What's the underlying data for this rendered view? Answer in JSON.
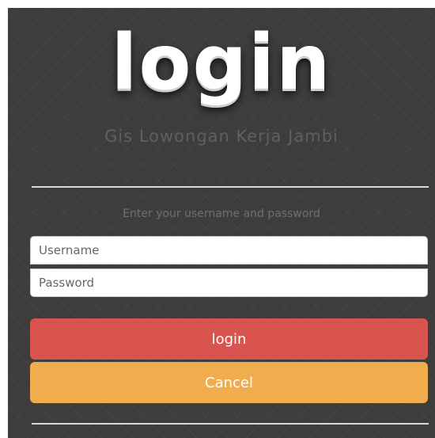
{
  "app": {
    "title": "login",
    "subtitle": "Gis Lowongan Kerja Jambi"
  },
  "form": {
    "hint": "Enter your username and password",
    "username_placeholder": "Username",
    "username_value": "",
    "password_placeholder": "Password",
    "password_value": "",
    "login_label": "login",
    "cancel_label": "Cancel"
  },
  "colors": {
    "background": "#3d3d3d",
    "login_button": "#d9534f",
    "cancel_button": "#f0ad4e"
  }
}
